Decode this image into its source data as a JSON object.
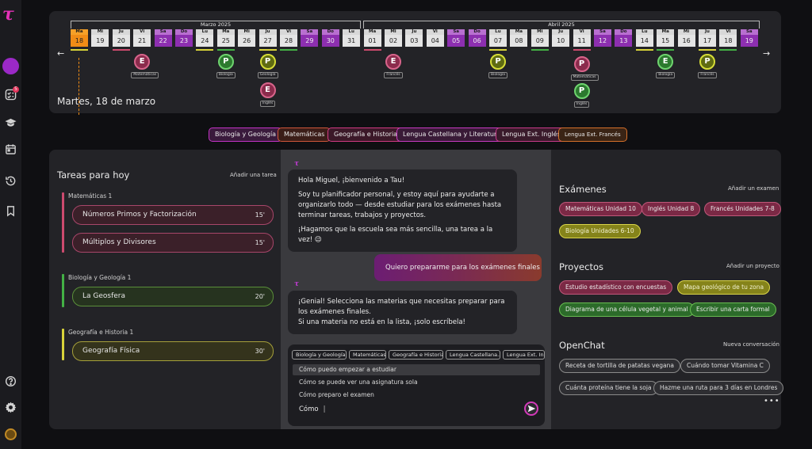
{
  "app": {
    "logo_glyph": "τ",
    "accent": "#e531b8"
  },
  "sidebar": {
    "notification_count": "5",
    "icons": [
      "tasks-icon",
      "graduation-cap-icon",
      "calendar-icon",
      "history-icon",
      "bookmark-icon",
      "help-icon",
      "settings-icon"
    ]
  },
  "calendar": {
    "months": [
      {
        "label": "Marzo 2025"
      },
      {
        "label": "Abril 2025"
      }
    ],
    "days": [
      {
        "dn": "Ma",
        "dd": "18",
        "type": "today"
      },
      {
        "dn": "Mi",
        "dd": "19",
        "type": "wd"
      },
      {
        "dn": "Ju",
        "dd": "20",
        "type": "wd"
      },
      {
        "dn": "Vi",
        "dd": "21",
        "type": "wd"
      },
      {
        "dn": "Sa",
        "dd": "22",
        "type": "wk"
      },
      {
        "dn": "Do",
        "dd": "23",
        "type": "wk"
      },
      {
        "dn": "Lu",
        "dd": "24",
        "type": "wd"
      },
      {
        "dn": "Ma",
        "dd": "25",
        "type": "wd"
      },
      {
        "dn": "Mi",
        "dd": "26",
        "type": "wd"
      },
      {
        "dn": "Ju",
        "dd": "27",
        "type": "wd"
      },
      {
        "dn": "Vi",
        "dd": "28",
        "type": "wd"
      },
      {
        "dn": "Sa",
        "dd": "29",
        "type": "wk"
      },
      {
        "dn": "Do",
        "dd": "30",
        "type": "wk"
      },
      {
        "dn": "Lu",
        "dd": "31",
        "type": "wd"
      },
      {
        "dn": "Ma",
        "dd": "01",
        "type": "wd"
      },
      {
        "dn": "Mi",
        "dd": "02",
        "type": "wd"
      },
      {
        "dn": "Ju",
        "dd": "03",
        "type": "wd"
      },
      {
        "dn": "Vi",
        "dd": "04",
        "type": "wd"
      },
      {
        "dn": "Sa",
        "dd": "05",
        "type": "wk"
      },
      {
        "dn": "Do",
        "dd": "06",
        "type": "wk"
      },
      {
        "dn": "Lu",
        "dd": "07",
        "type": "wd"
      },
      {
        "dn": "Ma",
        "dd": "08",
        "type": "wd"
      },
      {
        "dn": "Mi",
        "dd": "09",
        "type": "wd"
      },
      {
        "dn": "Ju",
        "dd": "10",
        "type": "wd"
      },
      {
        "dn": "Vi",
        "dd": "11",
        "type": "wd"
      },
      {
        "dn": "Sa",
        "dd": "12",
        "type": "wk"
      },
      {
        "dn": "Do",
        "dd": "13",
        "type": "wk"
      },
      {
        "dn": "Lu",
        "dd": "14",
        "type": "wd"
      },
      {
        "dn": "Ma",
        "dd": "15",
        "type": "wd"
      },
      {
        "dn": "Mi",
        "dd": "16",
        "type": "wd"
      },
      {
        "dn": "Ju",
        "dd": "17",
        "type": "wd"
      },
      {
        "dn": "Vi",
        "dd": "18",
        "type": "wd"
      },
      {
        "dn": "Sa",
        "dd": "19",
        "type": "wk"
      }
    ],
    "events": [
      {
        "letter": "E",
        "label": "Matemáticas"
      },
      {
        "letter": "P",
        "label": "Biología"
      },
      {
        "letter": "P",
        "label": "Geología"
      },
      {
        "letter": "E",
        "label": "Inglés"
      },
      {
        "letter": "E",
        "label": "Francés"
      },
      {
        "letter": "P",
        "label": "Biología"
      },
      {
        "letter": "P",
        "label": "Matemáticas"
      },
      {
        "letter": "P",
        "label": "Inglés"
      },
      {
        "letter": "E",
        "label": "Biología"
      },
      {
        "letter": "P",
        "label": "Francés"
      }
    ],
    "selected_date": "Martes, 18 de marzo"
  },
  "subjects": [
    {
      "label": "Biología y Geología"
    },
    {
      "label": "Matemáticas"
    },
    {
      "label": "Geografía e Historia"
    },
    {
      "label": "Lengua Castellana y Literatura"
    },
    {
      "label": "Lengua Ext. Inglés"
    },
    {
      "label": "Lengua Ext. Francés"
    }
  ],
  "tasks": {
    "title": "Tareas para hoy",
    "add_label": "Añadir una tarea",
    "groups": [
      {
        "title": "Matemáticas 1",
        "items": [
          {
            "name": "Números Primos y Factorización",
            "mins": "15'"
          },
          {
            "name": "Múltiplos y Divisores",
            "mins": "15'"
          }
        ]
      },
      {
        "title": "Biología y Geología 1",
        "items": [
          {
            "name": "La Geosfera",
            "mins": "20'"
          }
        ]
      },
      {
        "title": "Geografía e Historia 1",
        "items": [
          {
            "name": "Geografía Física",
            "mins": "30'"
          }
        ]
      }
    ]
  },
  "chat": {
    "bot_glyph": "τ",
    "msg1": [
      "Hola Miguel, ¡bienvenido a Tau!",
      "Soy tu planificador personal, y estoy aquí para ayudarte a organizarlo todo — desde estudiar para los exámenes hasta terminar tareas, trabajos y proyectos.",
      "¡Hagamos que la escuela sea más sencilla, una tarea a la vez! 😉"
    ],
    "user_msg": "Quiero prepararme para los exámenes finales",
    "msg2": [
      "¡Genial! Selecciona las materias que necesitas preparar para los exámenes finales.",
      "Si una materia no está en la lista, ¡solo escríbela!"
    ],
    "chips": [
      "Biología y Geología",
      "Matemáticas",
      "Geografía e Historia",
      "Lengua Castellana...",
      "Lengua Ext. Ingl..."
    ],
    "suggestions": [
      "Cómo puedo empezar a estudiar",
      "Cómo se puede ver una asignatura sola",
      "Cómo preparo el examen"
    ],
    "input_value": "Cómo"
  },
  "exams": {
    "title": "Exámenes",
    "add_label": "Añadir un examen",
    "items": [
      {
        "label": "Matemáticas Unidad 10"
      },
      {
        "label": "Inglés Unidad 8"
      },
      {
        "label": "Francés Unidades 7-8"
      },
      {
        "label": "Biología Unidades 6-10"
      }
    ]
  },
  "projects": {
    "title": "Proyectos",
    "add_label": "Añadir un proyecto",
    "items": [
      {
        "label": "Estudio estadístico con encuestas"
      },
      {
        "label": "Mapa geológico de tu zona"
      },
      {
        "label": "Diagrama de una célula vegetal y animal"
      },
      {
        "label": "Escribir una carta formal"
      }
    ]
  },
  "openchat": {
    "title": "OpenChat",
    "add_label": "Nueva conversación",
    "items": [
      {
        "label": "Receta de tortilla de patatas vegana"
      },
      {
        "label": "Cuándo tomar Vitamina C"
      },
      {
        "label": "Cuánta proteína tiene la soja"
      },
      {
        "label": "Hazme una ruta para 3 días en Londres"
      }
    ],
    "more_glyph": "•••"
  }
}
